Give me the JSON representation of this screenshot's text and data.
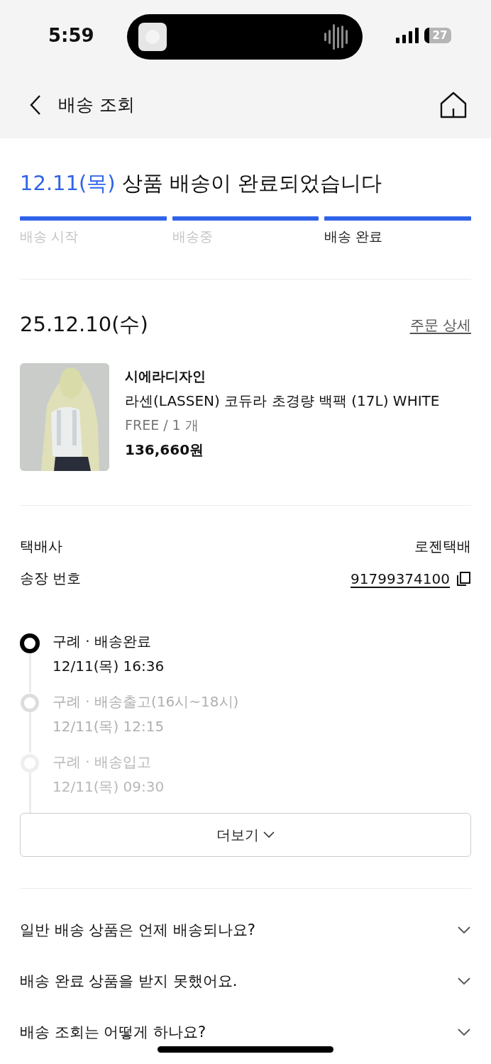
{
  "status_bar": {
    "time": "5:59",
    "battery": "27"
  },
  "header": {
    "title": "배송 조회"
  },
  "delivery": {
    "date": "12.11(목)",
    "message": "상품 배송이 완료되었습니다",
    "steps": [
      {
        "label": "배송 시작",
        "selected": false
      },
      {
        "label": "배송중",
        "selected": false
      },
      {
        "label": "배송 완료",
        "selected": true
      }
    ]
  },
  "order": {
    "date": "25.12.10(수)",
    "detail_link": "주문 상세",
    "product": {
      "kind": "picture",
      "brand": "시에라디자인",
      "name": "라센(LASSEN) 코듀라 초경량 백팩 (17L) WHITE",
      "option": "FREE / 1 개",
      "price": "136,660원"
    }
  },
  "shipping": {
    "carrier_label": "택배사",
    "carrier": "로젠택배",
    "invoice_label": "송장 번호",
    "invoice": "91799374100"
  },
  "tracking": [
    {
      "status": "구례 · 배송완료",
      "time": "12/11(목) 16:36",
      "active": true
    },
    {
      "status": "구례 · 배송출고(16시~18시)",
      "time": "12/11(목) 12:15",
      "active": false
    },
    {
      "status": "구례 · 배송입고",
      "time": "12/11(목) 09:30",
      "active": false
    }
  ],
  "more_button": "더보기",
  "faq": [
    {
      "question": "일반 배송 상품은 언제 배송되나요?",
      "expanded": false
    },
    {
      "question": "배송 완료 상품을 받지 못했어요.",
      "expanded": false
    },
    {
      "question": "배송 조회는 어떻게 하나요?",
      "expanded": false
    }
  ]
}
